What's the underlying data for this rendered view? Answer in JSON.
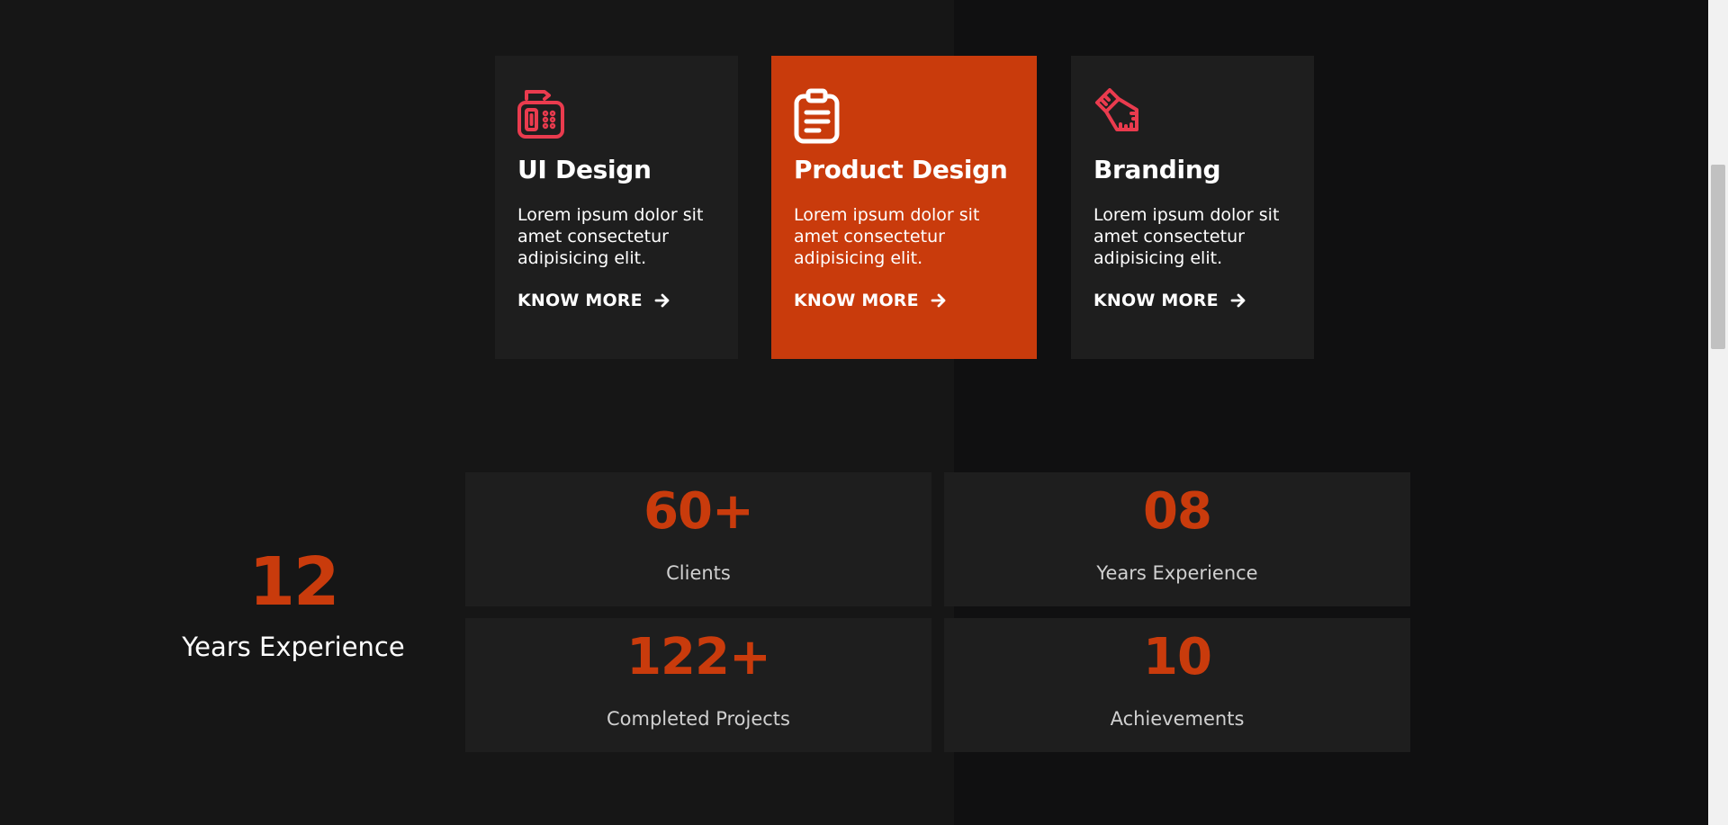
{
  "colors": {
    "accent": "#c93b0c",
    "icon_red": "#ea3b4e",
    "card_bg": "#1e1e1e",
    "page_bg": "#161616"
  },
  "services": [
    {
      "icon": "fax-machine-icon",
      "title": "UI Design",
      "text": "Lorem ipsum dolor sit amet consectetur adipisicing elit.",
      "link": "KNOW MORE"
    },
    {
      "icon": "clipboard-icon",
      "title": "Product Design",
      "text": "Lorem ipsum dolor sit amet consectetur adipisicing elit.",
      "link": "KNOW MORE"
    },
    {
      "icon": "ruler-icon",
      "title": "Branding",
      "text": "Lorem ipsum dolor sit amet consectetur adipisicing elit.",
      "link": "KNOW MORE"
    }
  ],
  "experience": {
    "value": "12",
    "label": "Years Experience"
  },
  "stats": [
    {
      "value": "60+",
      "label": "Clients"
    },
    {
      "value": "08",
      "label": "Years Experience"
    },
    {
      "value": "122+",
      "label": "Completed Projects"
    },
    {
      "value": "10",
      "label": "Achievements"
    }
  ]
}
